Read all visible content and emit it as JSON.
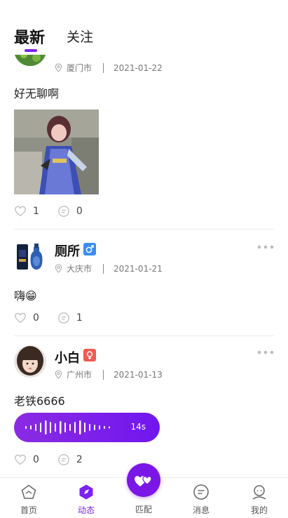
{
  "tabs": {
    "latest": "最新",
    "follow": "关注"
  },
  "posts": [
    {
      "location": "厦门市",
      "date": "2021-01-22",
      "text": "好无聊啊",
      "likes": "1",
      "comments": "0"
    },
    {
      "name": "厕所",
      "location": "大庆市",
      "date": "2021-01-21",
      "text": "嗨😁",
      "likes": "0",
      "comments": "1",
      "badge_color": "#3a8df5"
    },
    {
      "name": "小白",
      "location": "广州市",
      "date": "2021-01-13",
      "text": "老铁6666",
      "voice_duration": "14s",
      "likes": "0",
      "comments": "2",
      "badge_color": "#f05a4f"
    }
  ],
  "tabbar": {
    "home": "首页",
    "moments": "动态",
    "match": "匹配",
    "messages": "消息",
    "mine": "我的"
  },
  "colors": {
    "accent": "#7b22f0"
  }
}
